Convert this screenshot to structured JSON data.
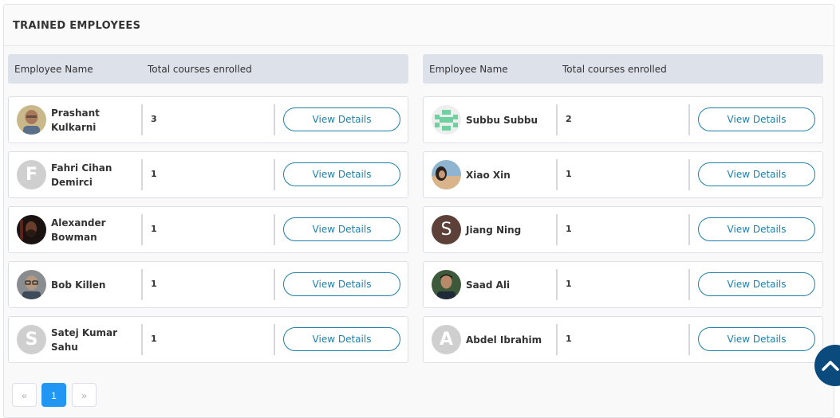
{
  "panel": {
    "title": "TRAINED EMPLOYEES"
  },
  "columns": {
    "name_header": "Employee Name",
    "courses_header": "Total courses enrolled"
  },
  "view_details_label": "View Details",
  "left": [
    {
      "name": "Prashant Kulkarni",
      "courses": "3",
      "avatar": "photo-bald-man-icon"
    },
    {
      "name": "Fahri Cihan Demirci",
      "courses": "1",
      "avatar_letter": "F"
    },
    {
      "name": "Alexander Bowman",
      "courses": "1",
      "avatar": "photo-bearded-man-icon"
    },
    {
      "name": "Bob Killen",
      "courses": "1",
      "avatar": "photo-man-glasses-icon"
    },
    {
      "name": "Satej Kumar Sahu",
      "courses": "1",
      "avatar_letter": "S"
    }
  ],
  "right": [
    {
      "name": "Subbu Subbu",
      "courses": "2",
      "avatar": "identicon-green-icon"
    },
    {
      "name": "Xiao Xin",
      "courses": "1",
      "avatar": "photo-woman-beach-icon"
    },
    {
      "name": "Jiang Ning",
      "courses": "1",
      "avatar_letter": "S"
    },
    {
      "name": "Saad Ali",
      "courses": "1",
      "avatar": "photo-young-man-icon"
    },
    {
      "name": "Abdel Ibrahim",
      "courses": "1",
      "avatar_letter": "A"
    }
  ],
  "pagination": {
    "prev": "«",
    "current": "1",
    "next": "»"
  },
  "colors": {
    "accent": "#1e7fa8",
    "header_bg": "#dde1e9",
    "page_active": "#2196f3",
    "scroll_btn": "#0b4a7c"
  }
}
